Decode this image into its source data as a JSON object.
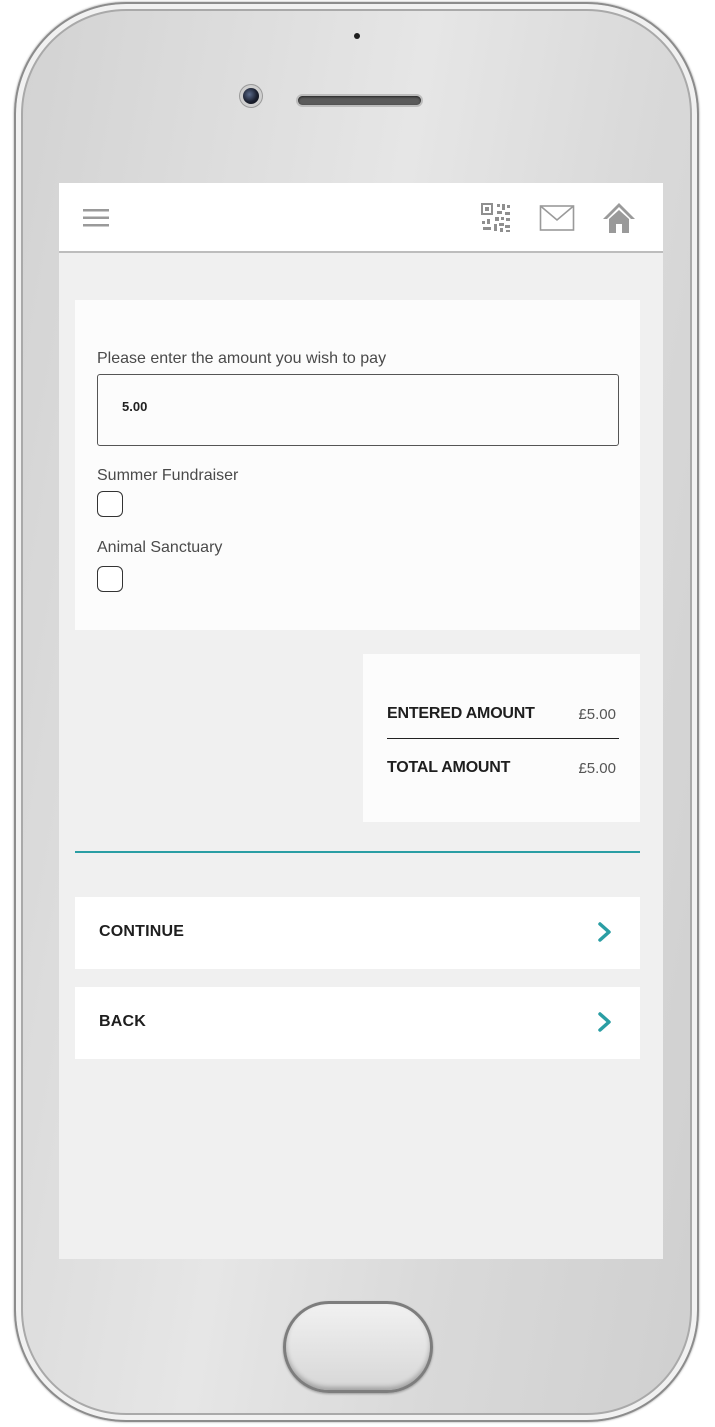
{
  "header": {
    "menu_icon": "hamburger-menu-icon",
    "qr_icon": "qr-code-icon",
    "mail_icon": "envelope-icon",
    "home_icon": "home-icon"
  },
  "form": {
    "amount_label": "Please enter the amount you wish to pay",
    "amount_value": "5.00",
    "options": [
      {
        "label": "Summer Fundraiser",
        "checked": false
      },
      {
        "label": "Animal Sanctuary",
        "checked": false
      }
    ]
  },
  "summary": {
    "entered_label": "ENTERED AMOUNT",
    "entered_value": "£5.00",
    "total_label": "TOTAL AMOUNT",
    "total_value": "£5.00"
  },
  "actions": {
    "continue_label": "CONTINUE",
    "back_label": "BACK"
  },
  "colors": {
    "accent": "#2a9ea4",
    "header_icons": "#9a9a9a"
  }
}
